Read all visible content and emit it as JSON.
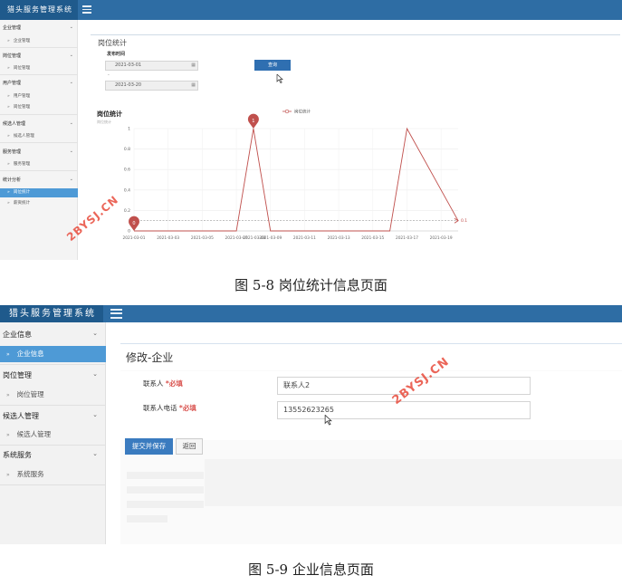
{
  "fig1": {
    "brand": "猎头服务管理系统",
    "sidebar": [
      {
        "group": "企业管理",
        "items": [
          "企业管理"
        ]
      },
      {
        "group": "岗位管理",
        "items": [
          "岗位管理"
        ]
      },
      {
        "group": "用户管理",
        "items": [
          "用户管理",
          "岗位管理"
        ]
      },
      {
        "group": "候选人管理",
        "items": [
          "候选人管理"
        ]
      },
      {
        "group": "服务管理",
        "items": [
          "服务管理"
        ]
      },
      {
        "group": "统计分析",
        "items": [
          "岗位统计",
          "薪资统计"
        ]
      }
    ],
    "page_title": "岗位统计",
    "filter_label": "发布时间",
    "date_from": "2021-03-01",
    "date_to": "2021-03-20",
    "date_sep": "-",
    "query_button": "查询",
    "section_title": "岗位统计",
    "section_sub": "岗位统计"
  },
  "chart_data": {
    "type": "line",
    "legend": "岗位统计",
    "legend_position": "top-center",
    "x": [
      "2021-03-01",
      "2021-03-03",
      "2021-03-05",
      "2021-03-07",
      "2021-03-09",
      "2021-03-11",
      "2021-03-13",
      "2021-03-15",
      "2021-03-17",
      "2021-03-19"
    ],
    "x_extra_label": "2021-03-08",
    "ylim": [
      0,
      1
    ],
    "yticks": [
      "0",
      "0.2",
      "0.4",
      "0.6",
      "0.8",
      "1"
    ],
    "points": [
      {
        "x": "2021-03-01",
        "y": 0
      },
      {
        "x": "2021-03-07",
        "y": 0
      },
      {
        "x": "2021-03-08",
        "y": 1
      },
      {
        "x": "2021-03-09",
        "y": 0
      },
      {
        "x": "2021-03-16",
        "y": 0
      },
      {
        "x": "2021-03-17",
        "y": 1
      },
      {
        "x": "2021-03-20",
        "y": 0.1
      }
    ],
    "markers": [
      {
        "label": "1",
        "x": "2021-03-08",
        "y": 1
      },
      {
        "label": "0",
        "x": "2021-03-01",
        "y": 0
      }
    ],
    "avg_line_label": "0.1",
    "avg_value": 0.1,
    "grid": true,
    "color": "#c0504d"
  },
  "caption1": "图 5-8 岗位统计信息页面",
  "fig2": {
    "brand": "猎头服务管理系统",
    "sidebar": [
      {
        "group": "企业信息",
        "items": [
          "企业信息"
        ]
      },
      {
        "group": "岗位管理",
        "items": [
          "岗位管理"
        ]
      },
      {
        "group": "候选人管理",
        "items": [
          "候选人管理"
        ]
      },
      {
        "group": "系统服务",
        "items": [
          "系统服务"
        ]
      }
    ],
    "page_title": "修改-企业",
    "contact_label": "联系人",
    "contact_required": "*必填",
    "contact_value": "联系人2",
    "phone_label": "联系人电话",
    "phone_required": "*必填",
    "phone_value": "13552623265",
    "submit_button": "提交并保存",
    "back_button": "返回"
  },
  "caption2": "图 5-9 企业信息页面",
  "watermark": "2BYSJ.CN"
}
